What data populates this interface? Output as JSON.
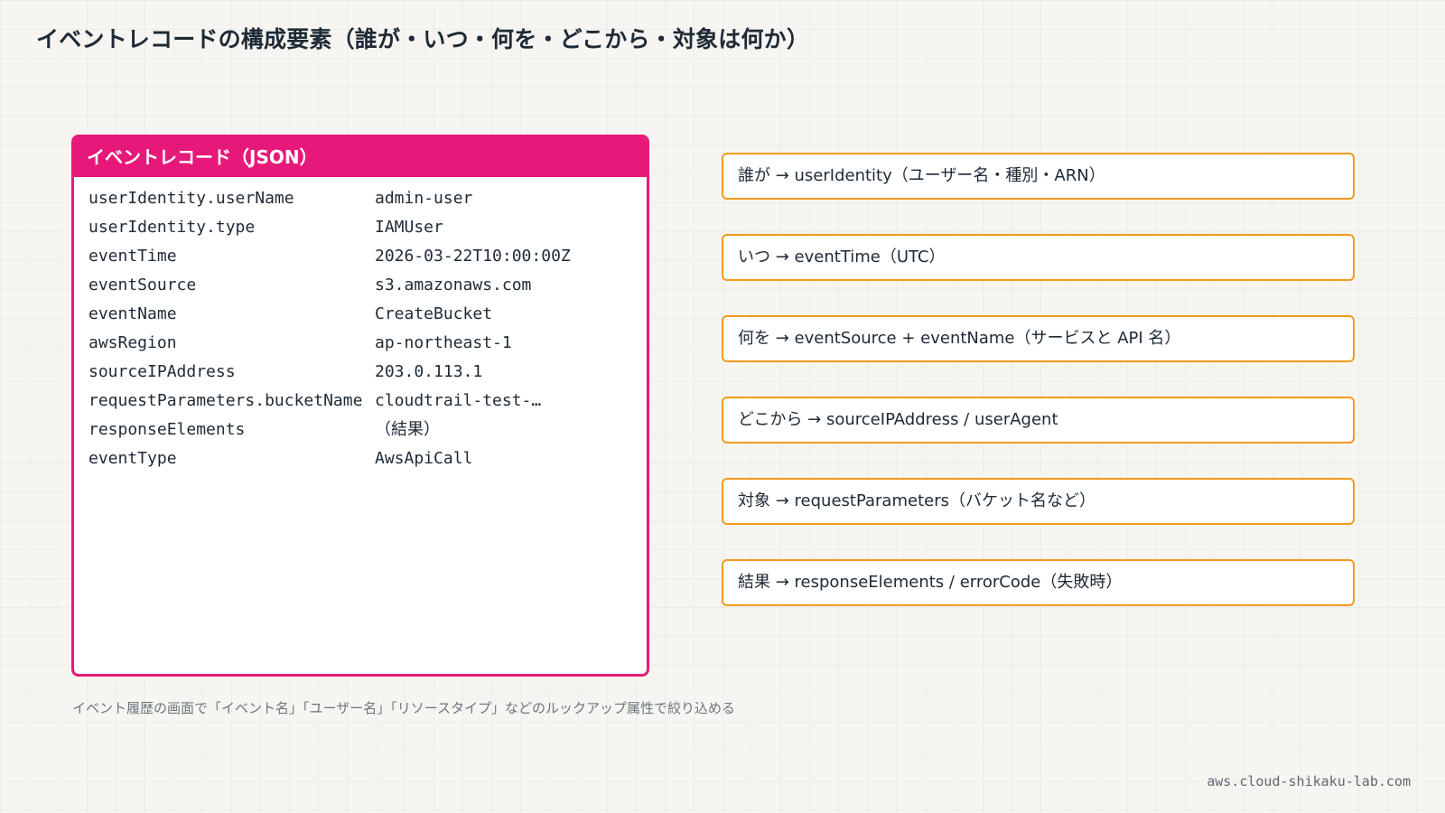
{
  "title": "イベントレコードの構成要素（誰が・いつ・何を・どこから・対象は何か）",
  "json_panel": {
    "header": "イベントレコード（JSON）",
    "rows": [
      {
        "key": "userIdentity.userName",
        "value": "admin-user"
      },
      {
        "key": "userIdentity.type",
        "value": "IAMUser"
      },
      {
        "key": "eventTime",
        "value": "2026-03-22T10:00:00Z"
      },
      {
        "key": "eventSource",
        "value": "s3.amazonaws.com"
      },
      {
        "key": "eventName",
        "value": "CreateBucket"
      },
      {
        "key": "awsRegion",
        "value": "ap-northeast-1"
      },
      {
        "key": "sourceIPAddress",
        "value": "203.0.113.1"
      },
      {
        "key": "requestParameters.bucketName",
        "value": "cloudtrail-test-…"
      },
      {
        "key": "responseElements",
        "value": "（結果）"
      },
      {
        "key": "eventType",
        "value": "AwsApiCall"
      }
    ]
  },
  "mappings": [
    "誰が → userIdentity（ユーザー名・種別・ARN）",
    "いつ → eventTime（UTC）",
    "何を → eventSource + eventName（サービスと API 名）",
    "どこから → sourceIPAddress / userAgent",
    "対象 → requestParameters（バケット名など）",
    "結果 → responseElements / errorCode（失敗時）"
  ],
  "footnote": "イベント履歴の画面で「イベント名」「ユーザー名」「リソースタイプ」などのルックアップ属性で絞り込める",
  "site_url": "aws.cloud-shikaku-lab.com",
  "colors": {
    "json_accent": "#e6197a",
    "mapping_border": "#f29a1e",
    "text_dark": "#1e2a36",
    "text_muted": "#6c7580"
  }
}
